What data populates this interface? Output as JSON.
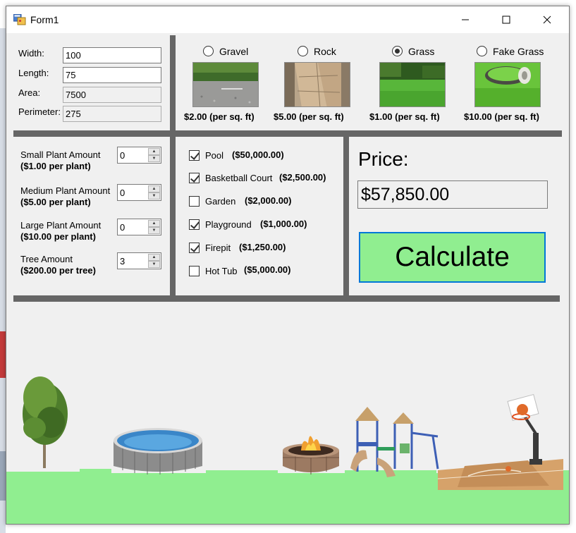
{
  "window": {
    "title": "Form1"
  },
  "dimensions": {
    "width_label": "Width:",
    "width_value": "100",
    "length_label": "Length:",
    "length_value": "75",
    "area_label": "Area:",
    "area_value": "7500",
    "perimeter_label": "Perimeter:",
    "perimeter_value": "275"
  },
  "surfaces": [
    {
      "label": "Gravel",
      "price": "$2.00 (per sq. ft)",
      "selected": false
    },
    {
      "label": "Rock",
      "price": "$5.00 (per sq. ft)",
      "selected": false
    },
    {
      "label": "Grass",
      "price": "$1.00 (per sq. ft)",
      "selected": true
    },
    {
      "label": "Fake Grass",
      "price": "$10.00 (per sq. ft)",
      "selected": false
    }
  ],
  "plants": [
    {
      "label": "Small Plant Amount",
      "price": "($1.00 per plant)",
      "value": "0"
    },
    {
      "label": "Medium Plant Amount",
      "price": "($5.00 per plant)",
      "value": "0"
    },
    {
      "label": "Large Plant Amount",
      "price": "($10.00 per plant)",
      "value": "0"
    },
    {
      "label": "Tree Amount",
      "price": "($200.00 per tree)",
      "value": "3"
    }
  ],
  "features": [
    {
      "label": "Pool",
      "price": "($50,000.00)",
      "checked": true
    },
    {
      "label": "Basketball Court",
      "price": "($2,500.00)",
      "checked": true
    },
    {
      "label": "Garden",
      "price": "($2,000.00)",
      "checked": false
    },
    {
      "label": "Playground",
      "price": "($1,000.00)",
      "checked": true
    },
    {
      "label": "Firepit",
      "price": "($1,250.00)",
      "checked": true
    },
    {
      "label": "Hot Tub",
      "price": "($5,000.00)",
      "checked": false
    }
  ],
  "price": {
    "label": "Price:",
    "value": "$57,850.00"
  },
  "calculate": {
    "label": "Calculate"
  },
  "colors": {
    "ground": "#90ee90",
    "divider": "#666666",
    "button_border": "#0078d7"
  }
}
